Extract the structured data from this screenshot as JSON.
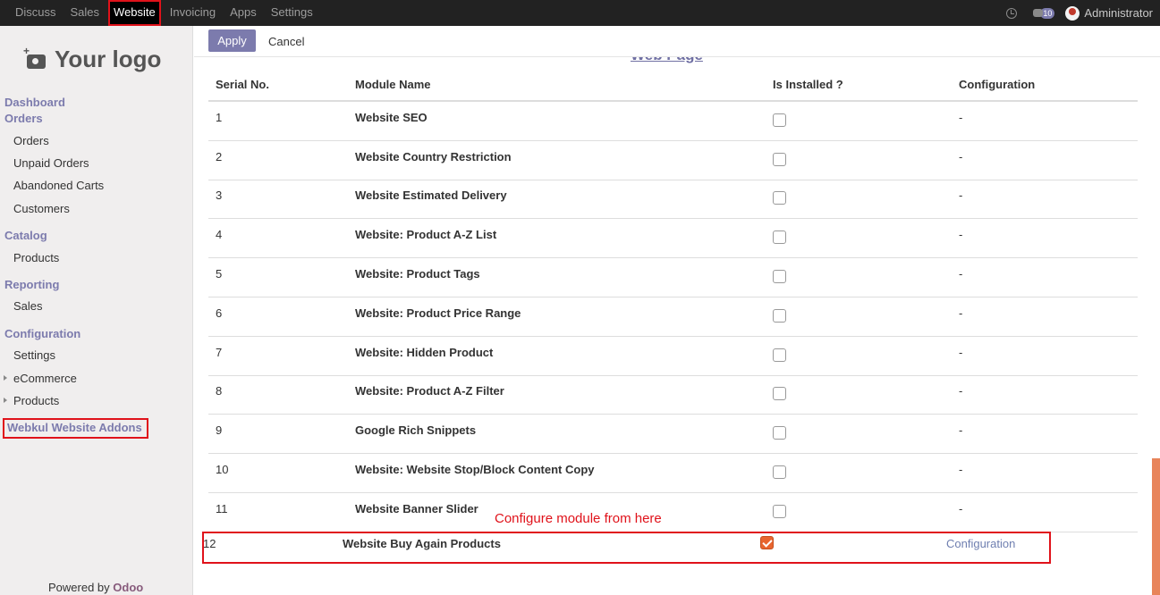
{
  "topnav": {
    "items": [
      {
        "label": "Discuss",
        "active": false
      },
      {
        "label": "Sales",
        "active": false
      },
      {
        "label": "Website",
        "active": true
      },
      {
        "label": "Invoicing",
        "active": false
      },
      {
        "label": "Apps",
        "active": false
      },
      {
        "label": "Settings",
        "active": false
      }
    ],
    "chat_count": "10",
    "user_name": "Administrator"
  },
  "sidebar": {
    "logo_text": "Your logo",
    "dashboard": "Dashboard",
    "orders_section": "Orders",
    "orders": "Orders",
    "unpaid_orders": "Unpaid Orders",
    "abandoned_carts": "Abandoned Carts",
    "customers": "Customers",
    "catalog_section": "Catalog",
    "products": "Products",
    "reporting_section": "Reporting",
    "sales": "Sales",
    "configuration_section": "Configuration",
    "settings": "Settings",
    "ecommerce": "eCommerce",
    "config_products": "Products",
    "addons": "Webkul Website Addons",
    "powered_by": "Powered by",
    "odoo": "Odoo"
  },
  "controls": {
    "apply": "Apply",
    "cancel": "Cancel"
  },
  "content": {
    "heading": "Web Page",
    "columns": [
      "Serial No.",
      "Module Name",
      "Is Installed ?",
      "Configuration"
    ],
    "rows": [
      {
        "serial": "1",
        "name": "Website SEO",
        "installed": false,
        "config": "-"
      },
      {
        "serial": "2",
        "name": "Website Country Restriction",
        "installed": false,
        "config": "-"
      },
      {
        "serial": "3",
        "name": "Website Estimated Delivery",
        "installed": false,
        "config": "-"
      },
      {
        "serial": "4",
        "name": "Website: Product A-Z List",
        "installed": false,
        "config": "-"
      },
      {
        "serial": "5",
        "name": "Website: Product Tags",
        "installed": false,
        "config": "-"
      },
      {
        "serial": "6",
        "name": "Website: Product Price Range",
        "installed": false,
        "config": "-"
      },
      {
        "serial": "7",
        "name": "Website: Hidden Product",
        "installed": false,
        "config": "-"
      },
      {
        "serial": "8",
        "name": "Website: Product A-Z Filter",
        "installed": false,
        "config": "-"
      },
      {
        "serial": "9",
        "name": "Google Rich Snippets",
        "installed": false,
        "config": "-"
      },
      {
        "serial": "10",
        "name": "Website: Website Stop/Block Content Copy",
        "installed": false,
        "config": "-"
      },
      {
        "serial": "11",
        "name": "Website Banner Slider",
        "installed": false,
        "config": "-"
      },
      {
        "serial": "12",
        "name": "Website Buy Again Products",
        "installed": true,
        "config": "Configuration"
      }
    ],
    "note": "Configure module from here"
  }
}
